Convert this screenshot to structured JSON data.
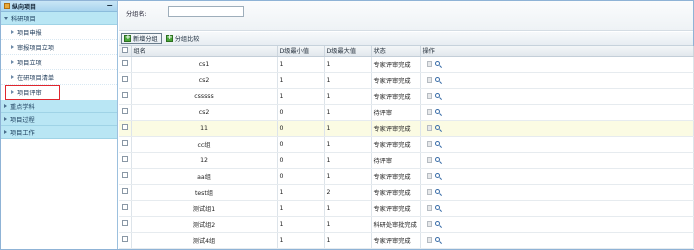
{
  "sidebar": {
    "header": "纵向项目",
    "collapse": "−",
    "sections": [
      {
        "label": "科研项目",
        "open": true
      },
      {
        "label": "重点学科",
        "open": false
      },
      {
        "label": "项目过程",
        "open": false
      },
      {
        "label": "项目工作",
        "open": false
      }
    ],
    "items": [
      {
        "label": "项目申报"
      },
      {
        "label": "审报项目立项"
      },
      {
        "label": "项目立项"
      },
      {
        "label": "在研项目清单"
      },
      {
        "label": "项目评审"
      }
    ]
  },
  "search": {
    "label": "分组名:",
    "value": ""
  },
  "toolbar": {
    "add_label": "新增分组",
    "compare_label": "分组比较"
  },
  "table": {
    "columns": [
      "",
      "组名",
      "D级最小值",
      "D级最大值",
      "状态",
      "操作"
    ],
    "rows": [
      {
        "name": "cs1",
        "dmin": "1",
        "dmax": "1",
        "status": "专家评审完成"
      },
      {
        "name": "cs2",
        "dmin": "1",
        "dmax": "1",
        "status": "专家评审完成"
      },
      {
        "name": "csssss",
        "dmin": "1",
        "dmax": "1",
        "status": "专家评审完成"
      },
      {
        "name": "cs2",
        "dmin": "0",
        "dmax": "1",
        "status": "待评审"
      },
      {
        "name": "11",
        "dmin": "0",
        "dmax": "1",
        "status": "专家评审完成"
      },
      {
        "name": "cc组",
        "dmin": "0",
        "dmax": "1",
        "status": "专家评审完成"
      },
      {
        "name": "12",
        "dmin": "0",
        "dmax": "1",
        "status": "待评审"
      },
      {
        "name": "aa组",
        "dmin": "0",
        "dmax": "1",
        "status": "专家评审完成"
      },
      {
        "name": "test组",
        "dmin": "1",
        "dmax": "2",
        "status": "专家评审完成"
      },
      {
        "name": "测试组1",
        "dmin": "1",
        "dmax": "1",
        "status": "专家评审完成"
      },
      {
        "name": "测试组2",
        "dmin": "1",
        "dmax": "1",
        "status": "科研处审批完成"
      },
      {
        "name": "测试4组",
        "dmin": "1",
        "dmax": "1",
        "status": "专家评审完成"
      }
    ]
  },
  "colors": {
    "sidebar_section_bg": "#b9e6f4",
    "active_outline": "#e0262e",
    "highlight_row": "#fbfbe3"
  }
}
